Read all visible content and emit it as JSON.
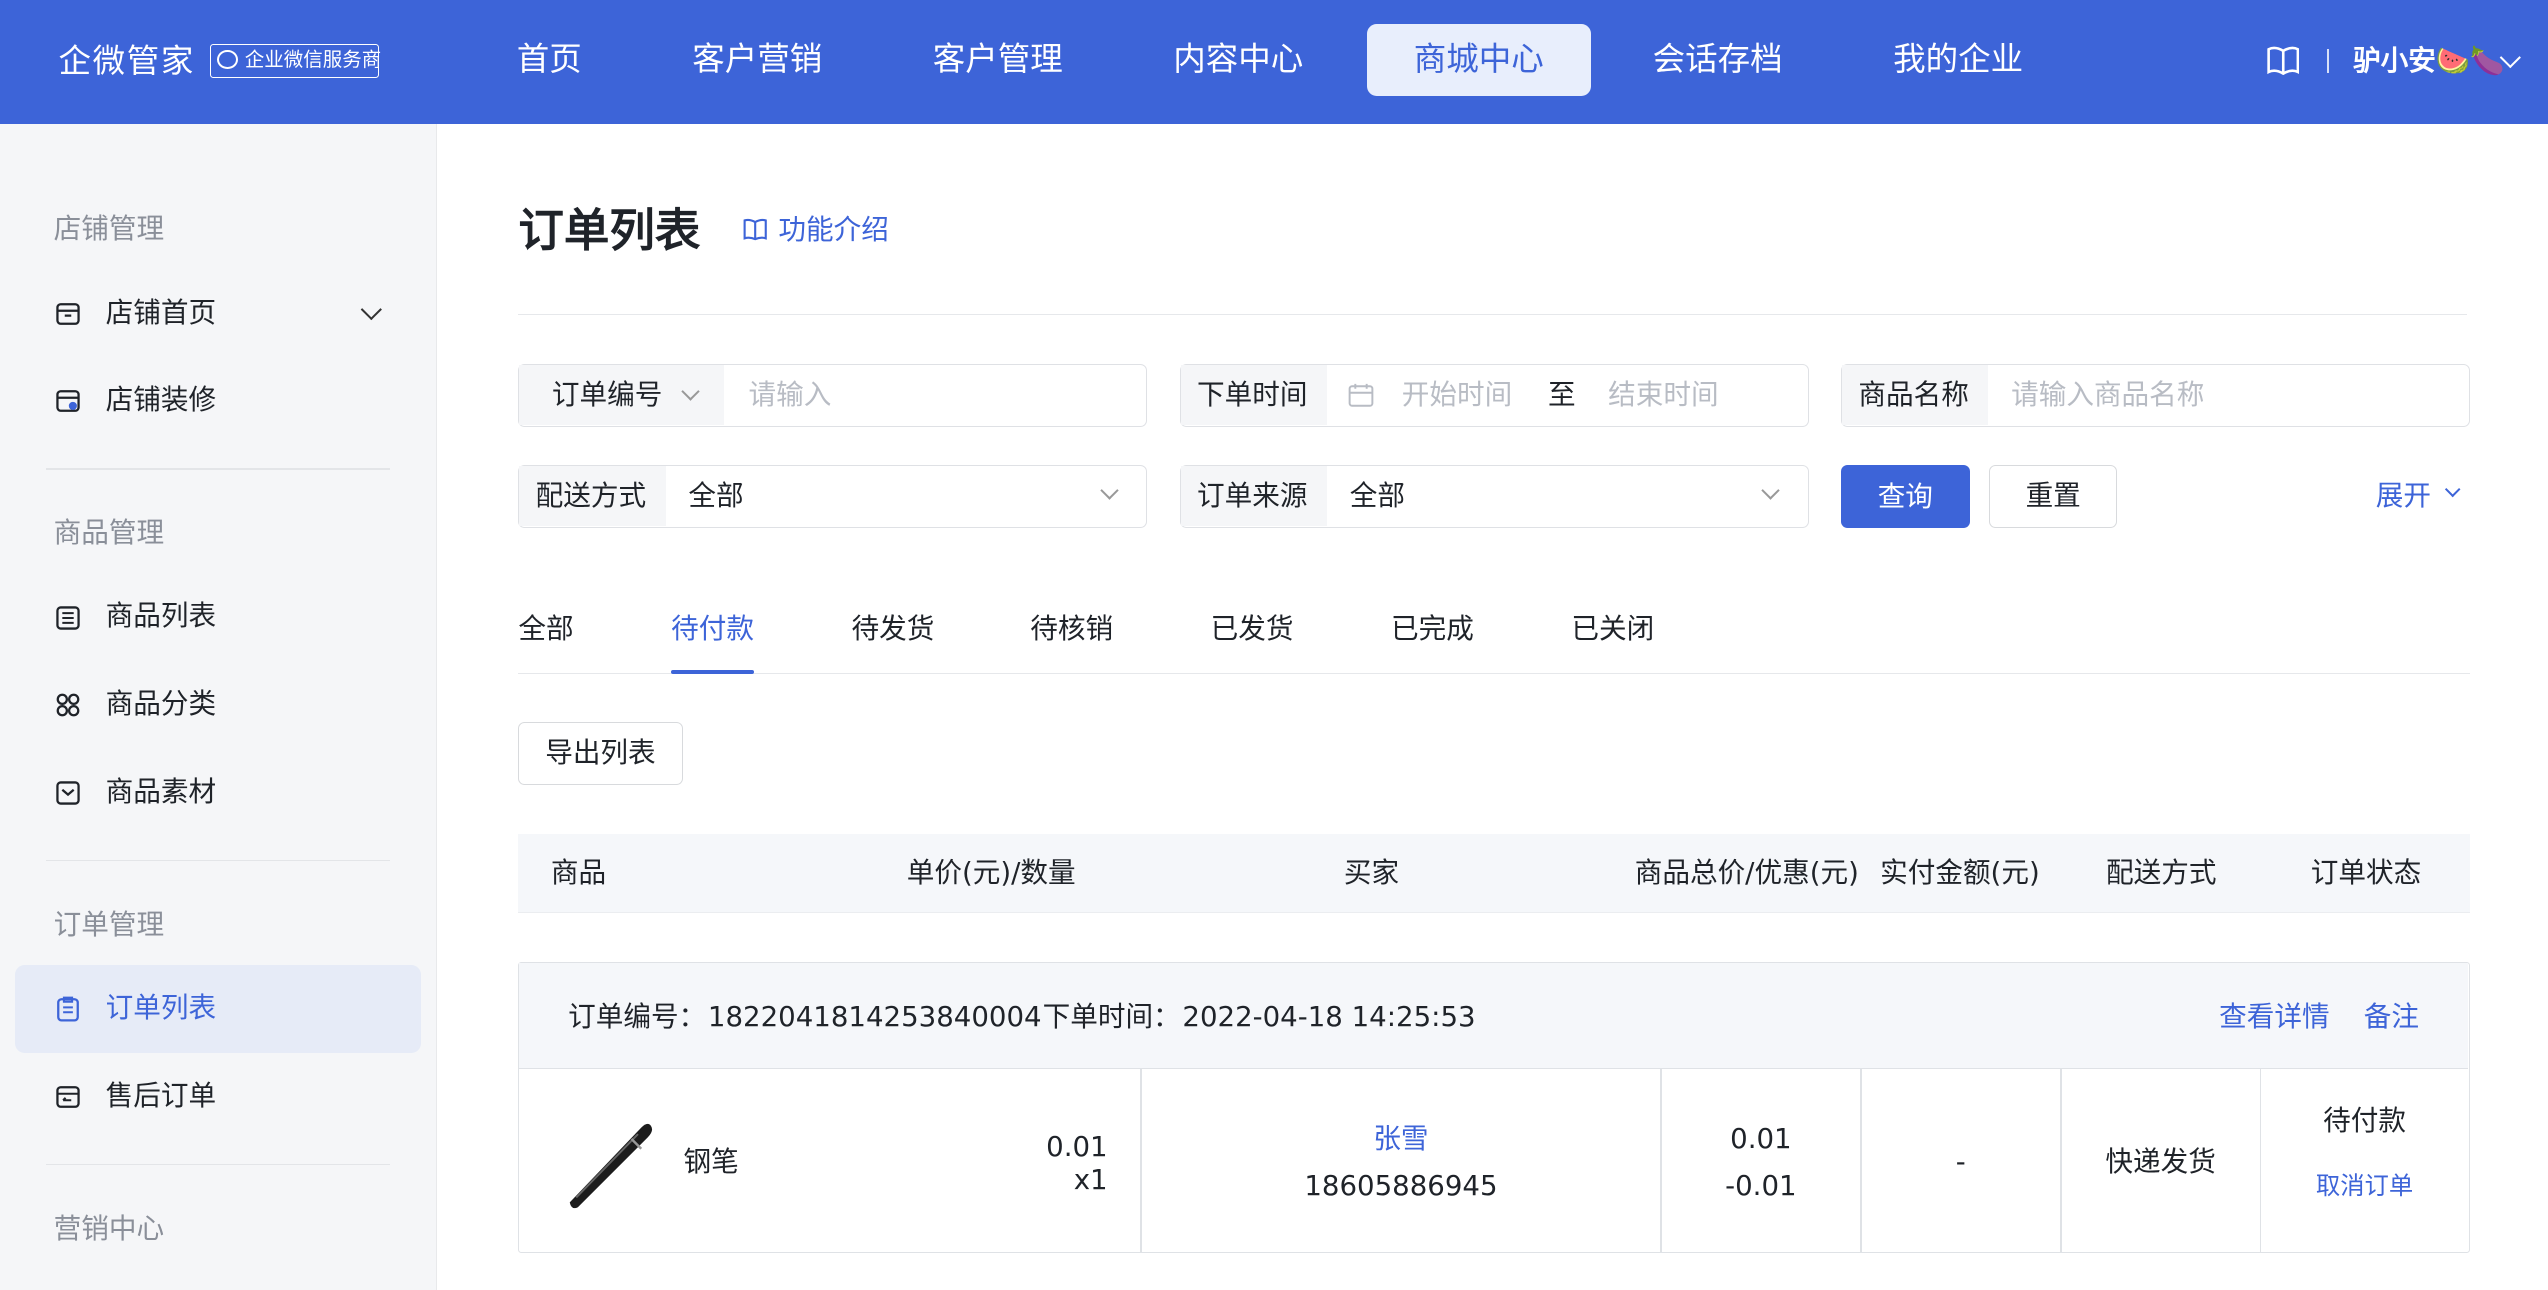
{
  "header": {
    "brand": "企微管家",
    "badge": "企业微信服务商",
    "nav": [
      "首页",
      "客户营销",
      "客户管理",
      "内容中心",
      "商城中心",
      "会话存档",
      "我的企业"
    ],
    "active_nav": "商城中心",
    "user_name": "驴小安🍉🍆"
  },
  "sidebar": {
    "groups": [
      {
        "title": "店铺管理",
        "items": [
          "店铺首页",
          "店铺装修"
        ]
      },
      {
        "title": "商品管理",
        "items": [
          "商品列表",
          "商品分类",
          "商品素材"
        ]
      },
      {
        "title": "订单管理",
        "items": [
          "订单列表",
          "售后订单"
        ]
      },
      {
        "title": "营销中心",
        "items": []
      }
    ],
    "active_item": "订单列表"
  },
  "page": {
    "title": "订单列表",
    "intro_link": "功能介绍"
  },
  "filters": {
    "order_no_label": "订单编号",
    "order_no_placeholder": "请输入",
    "time_label": "下单时间",
    "start_placeholder": "开始时间",
    "to": "至",
    "end_placeholder": "结束时间",
    "product_label": "商品名称",
    "product_placeholder": "请输入商品名称",
    "delivery_label": "配送方式",
    "delivery_value": "全部",
    "source_label": "订单来源",
    "source_value": "全部",
    "query": "查询",
    "reset": "重置",
    "expand": "展开"
  },
  "tabs": [
    "全部",
    "待付款",
    "待发货",
    "待核销",
    "已发货",
    "已完成",
    "已关闭"
  ],
  "active_tab": "待付款",
  "export_button": "导出列表",
  "table": {
    "headers": [
      "商品",
      "单价(元)/数量",
      "买家",
      "商品总价/优惠(元)",
      "实付金额(元)",
      "配送方式",
      "订单状态"
    ]
  },
  "order": {
    "order_no_label": "订单编号：",
    "order_no": "1822041814253840004",
    "time_label": "下单时间：",
    "time": "2022-04-18 14:25:53",
    "view_detail": "查看详情",
    "remark": "备注",
    "product_name": "钢笔",
    "unit_price": "0.01",
    "quantity": "x1",
    "buyer_name": "张雪",
    "buyer_phone": "18605886945",
    "total": "0.01",
    "discount": "-0.01",
    "paid": "-",
    "delivery": "快递发货",
    "status": "待付款",
    "cancel": "取消订单"
  },
  "colors": {
    "primary": "#3d64d8",
    "sidebar_bg": "#f5f6f8"
  }
}
